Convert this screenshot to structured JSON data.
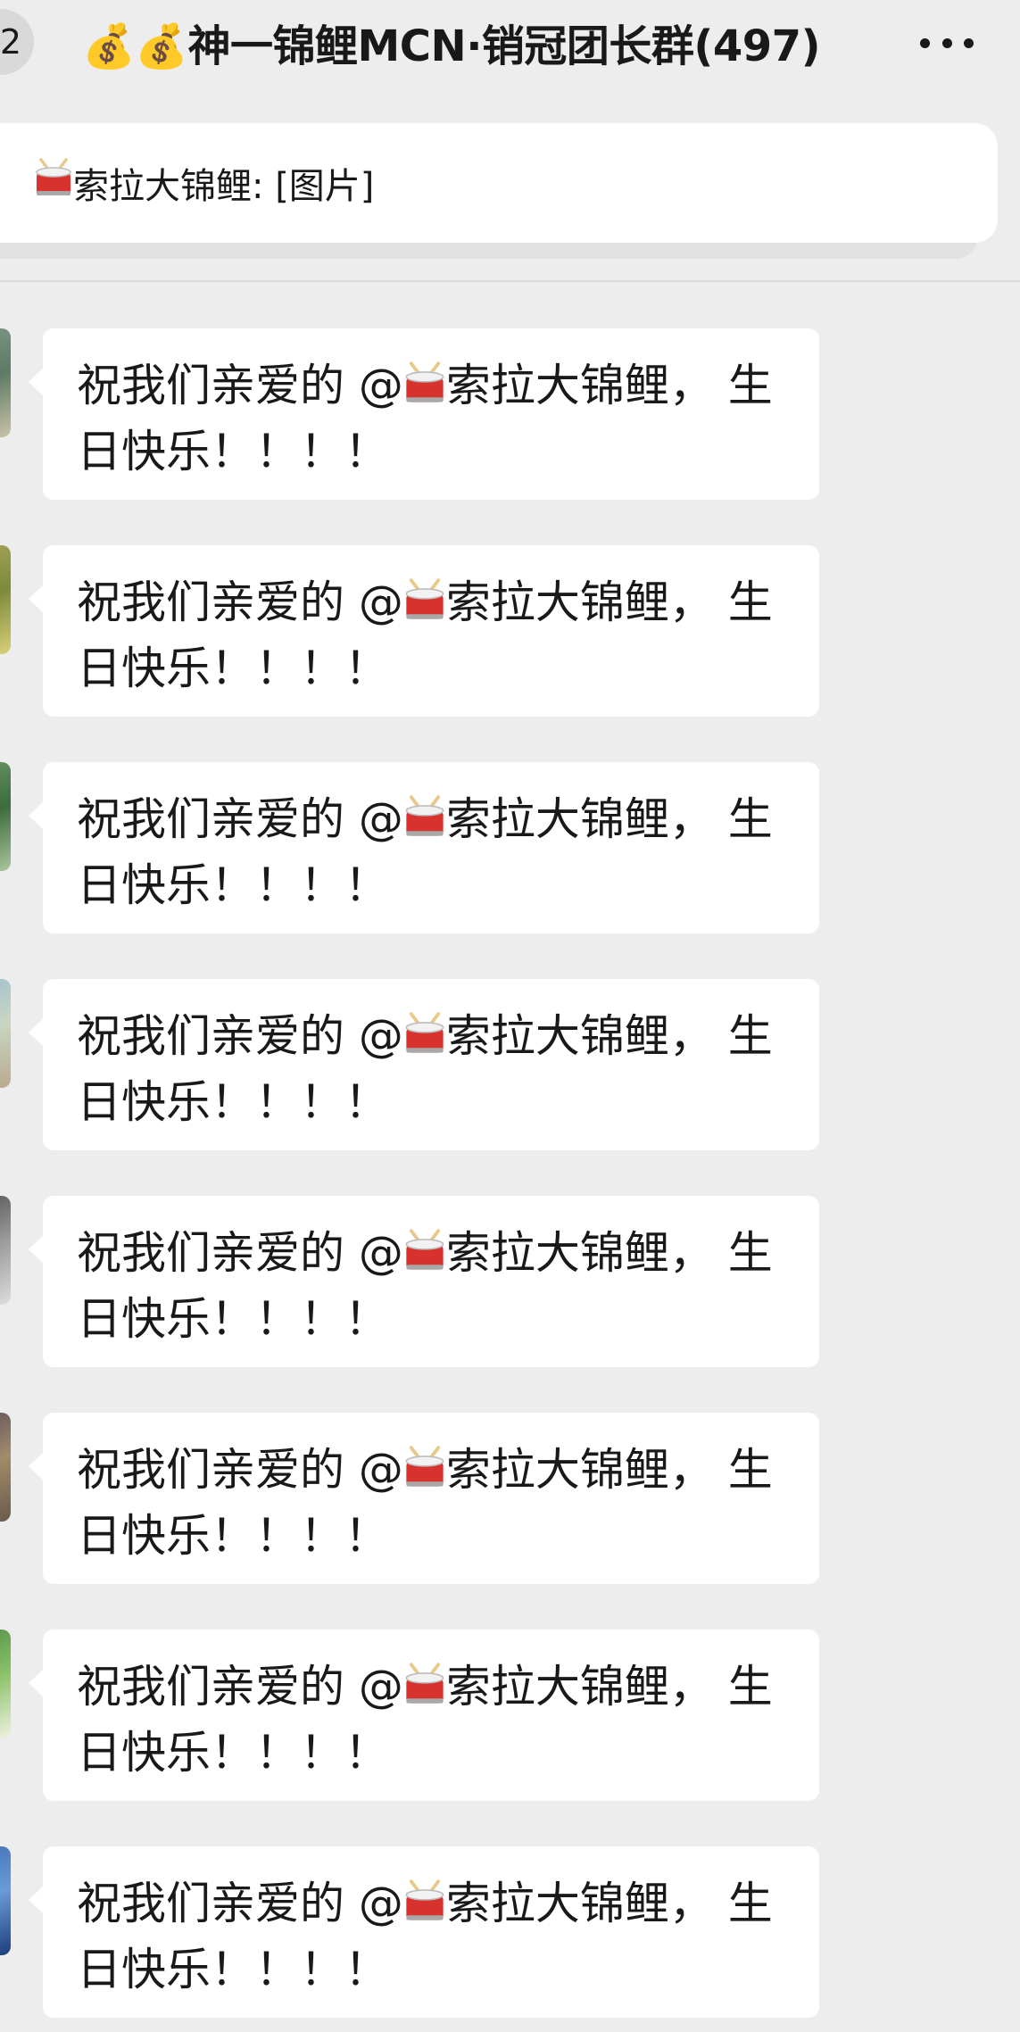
{
  "header": {
    "back_count": "2",
    "title": "💰💰神一锦鲤MCN·销冠团长群(497)",
    "more_icon": "more-dots-icon"
  },
  "pinned": {
    "sender_icon": "drum-icon",
    "text": "索拉大锦鲤: [图片]"
  },
  "messages": [
    {
      "line1_prefix": "祝我们亲爱的 @",
      "line1_suffix": "索拉大锦鲤， 生",
      "line2": "日快乐！！！！"
    },
    {
      "line1_prefix": "祝我们亲爱的 @",
      "line1_suffix": "索拉大锦鲤， 生",
      "line2": "日快乐！！！！"
    },
    {
      "line1_prefix": "祝我们亲爱的 @",
      "line1_suffix": "索拉大锦鲤， 生",
      "line2": "日快乐！！！！"
    },
    {
      "line1_prefix": "祝我们亲爱的 @",
      "line1_suffix": "索拉大锦鲤， 生",
      "line2": "日快乐！！！！"
    },
    {
      "line1_prefix": "祝我们亲爱的 @",
      "line1_suffix": "索拉大锦鲤， 生",
      "line2": "日快乐！！！！"
    },
    {
      "line1_prefix": "祝我们亲爱的 @",
      "line1_suffix": "索拉大锦鲤， 生",
      "line2": "日快乐！！！！"
    },
    {
      "line1_prefix": "祝我们亲爱的 @",
      "line1_suffix": "索拉大锦鲤， 生",
      "line2": "日快乐！！！！"
    },
    {
      "line1_prefix": "祝我们亲爱的 @",
      "line1_suffix": "索拉大锦鲤， 生",
      "line2": "日快乐！！！！"
    }
  ],
  "colors": {
    "background": "#ededed",
    "bubble": "#ffffff",
    "text": "#191919",
    "drum_red": "#d7322d"
  }
}
